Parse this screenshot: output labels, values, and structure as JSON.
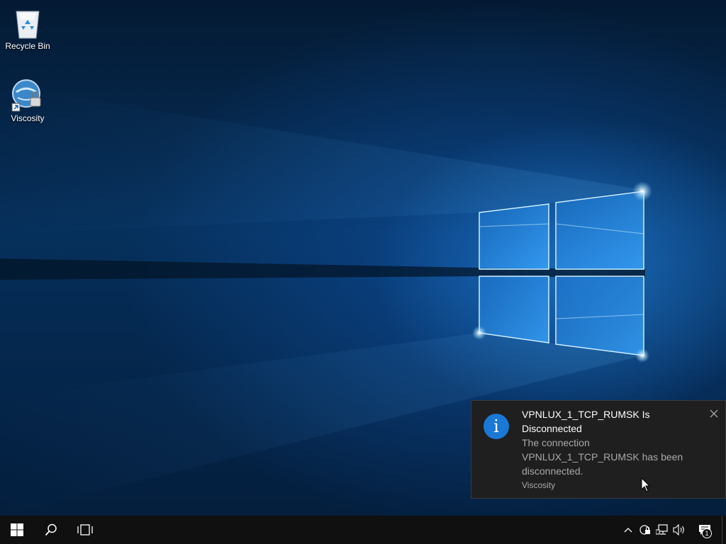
{
  "desktop": {
    "icons": [
      {
        "label": "Recycle Bin",
        "icon": "recycle-bin-icon"
      },
      {
        "label": "Viscosity",
        "icon": "viscosity-icon",
        "shortcut": true
      }
    ]
  },
  "notification": {
    "title": "VPNLUX_1_TCP_RUMSK Is Disconnected",
    "body": "The connection VPNLUX_1_TCP_RUMSK has been disconnected.",
    "app": "Viscosity",
    "info_glyph": "i",
    "accent": "#1a78d7"
  },
  "taskbar": {
    "start_icon": "windows-logo-icon",
    "search_icon": "search-icon",
    "taskview_icon": "task-view-icon",
    "tray": [
      "chevron-up-icon",
      "vpn-lock-icon",
      "network-icon",
      "volume-icon",
      "action-center-icon"
    ],
    "notification_count": "1"
  },
  "colors": {
    "taskbar": "#101010",
    "toast_bg": "#1f1f1f",
    "wallpaper_light": "#5cc8ff"
  }
}
